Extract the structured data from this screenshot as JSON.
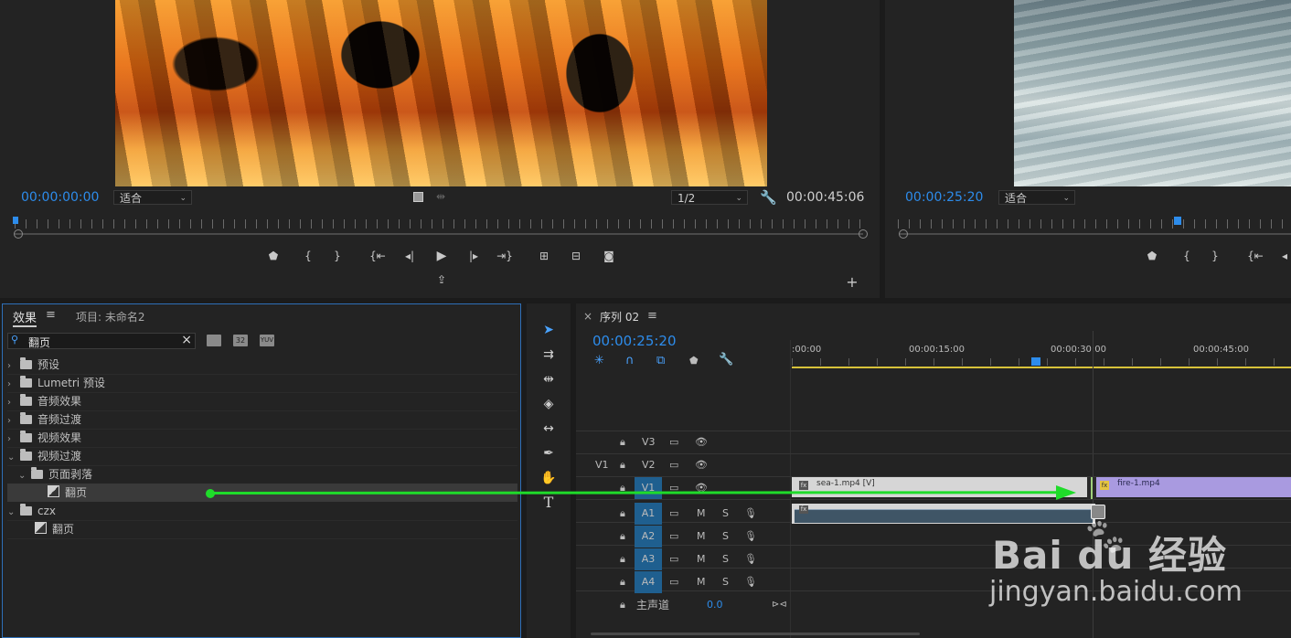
{
  "source_monitor": {
    "timecode_left": "00:00:00:00",
    "fit_label": "适合",
    "resolution": "1/2",
    "timecode_right": "00:00:45:06"
  },
  "program_monitor": {
    "timecode": "00:00:25:20",
    "fit_label": "适合"
  },
  "effects_panel": {
    "tab_effects": "效果",
    "tab_project": "项目: 未命名2",
    "search_value": "翻页",
    "toolbar_icons": [
      "accelerated-effects-icon",
      "32-bit-icon",
      "yuv-icon"
    ],
    "tree": [
      {
        "label": "预设",
        "expanded": false,
        "level": 0,
        "type": "folder-preset"
      },
      {
        "label": "Lumetri 预设",
        "expanded": false,
        "level": 0,
        "type": "folder-preset"
      },
      {
        "label": "音频效果",
        "expanded": false,
        "level": 0,
        "type": "folder"
      },
      {
        "label": "音频过渡",
        "expanded": false,
        "level": 0,
        "type": "folder"
      },
      {
        "label": "视频效果",
        "expanded": false,
        "level": 0,
        "type": "folder"
      },
      {
        "label": "视频过渡",
        "expanded": true,
        "level": 0,
        "type": "folder"
      },
      {
        "label": "页面剥落",
        "expanded": true,
        "level": 1,
        "type": "folder"
      },
      {
        "label": "翻页",
        "level": 2,
        "type": "effect",
        "selected": true
      },
      {
        "label": "czx",
        "expanded": true,
        "level": 0,
        "type": "folder"
      },
      {
        "label": "翻页",
        "level": 1,
        "type": "effect",
        "selected": false
      }
    ]
  },
  "timeline": {
    "close_glyph": "×",
    "sequence_name": "序列 02",
    "timecode": "00:00:25:20",
    "ruler_labels": [
      ":00:00",
      "00:00:15:00",
      "00:00:30:00",
      "00:00:45:00"
    ],
    "video_tracks": [
      {
        "name": "V3",
        "source": ""
      },
      {
        "name": "V2",
        "source": "V1"
      },
      {
        "name": "V1",
        "source": ""
      }
    ],
    "audio_tracks": [
      {
        "name": "A1",
        "m": "M",
        "s": "S"
      },
      {
        "name": "A2",
        "m": "M",
        "s": "S"
      },
      {
        "name": "A3",
        "m": "M",
        "s": "S"
      },
      {
        "name": "A4",
        "m": "M",
        "s": "S"
      }
    ],
    "master_label": "主声道",
    "master_value": "0.0",
    "clips": [
      {
        "label": "sea-1.mp4 [V]",
        "color": "#d6d6d6"
      },
      {
        "label": "fire-1.mp4",
        "color": "#a99ae0"
      }
    ]
  },
  "watermark": {
    "brand": "Bai du 经验",
    "url": "jingyan.baidu.com"
  },
  "colors": {
    "accent_blue": "#2d8ceb",
    "arrow_green": "#1fdc2a",
    "track_blue": "#1f5f8f",
    "clip_purple": "#a99ae0"
  }
}
